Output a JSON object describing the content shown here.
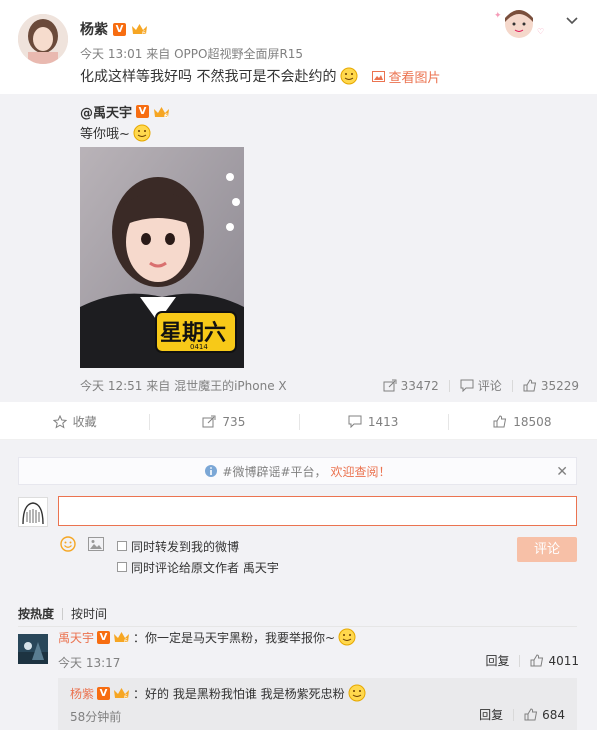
{
  "post": {
    "author": "杨紫",
    "time": "今天 13:01",
    "source_prefix": "来自",
    "source": "OPPO超视野全面屏R15",
    "text": "化成这样等我好吗 不然我可是不会赴约的",
    "view_image": "查看图片"
  },
  "retweet": {
    "author": "@禹天宇",
    "text": "等你哦~",
    "image_caption": "星期六",
    "image_date": "0414",
    "time": "今天 12:51",
    "source_prefix": "来自",
    "source": "混世魔王的iPhone X",
    "reposts": "33472",
    "comments_label": "评论",
    "likes": "35229"
  },
  "actions": {
    "favorite": "收藏",
    "repost": "735",
    "comment": "1413",
    "like": "18508"
  },
  "comment_box": {
    "notice_prefix": "#微博辟谣#平台，",
    "notice_highlight": "欢迎查阅！",
    "close": "✕",
    "option_repost": "同时转发到我的微博",
    "option_comment_original": "同时评论给原文作者 禹天宇",
    "submit": "评论"
  },
  "sort": {
    "by_hot": "按热度",
    "by_time": "按时间"
  },
  "comments": [
    {
      "author": "禹天宇",
      "text": "：你一定是马天宇黑粉，我要举报你~",
      "time": "今天 13:17",
      "reply_label": "回复",
      "likes": "4011"
    }
  ],
  "reply": {
    "author": "杨紫",
    "text": "：好的 我是黑粉我怕谁 我是杨紫死忠粉",
    "time": "58分钟前",
    "reply_label": "回复",
    "likes": "684"
  },
  "colors": {
    "accent": "#eb7350",
    "vip": "#f76d11",
    "gray_bg": "#f2f2f5"
  }
}
